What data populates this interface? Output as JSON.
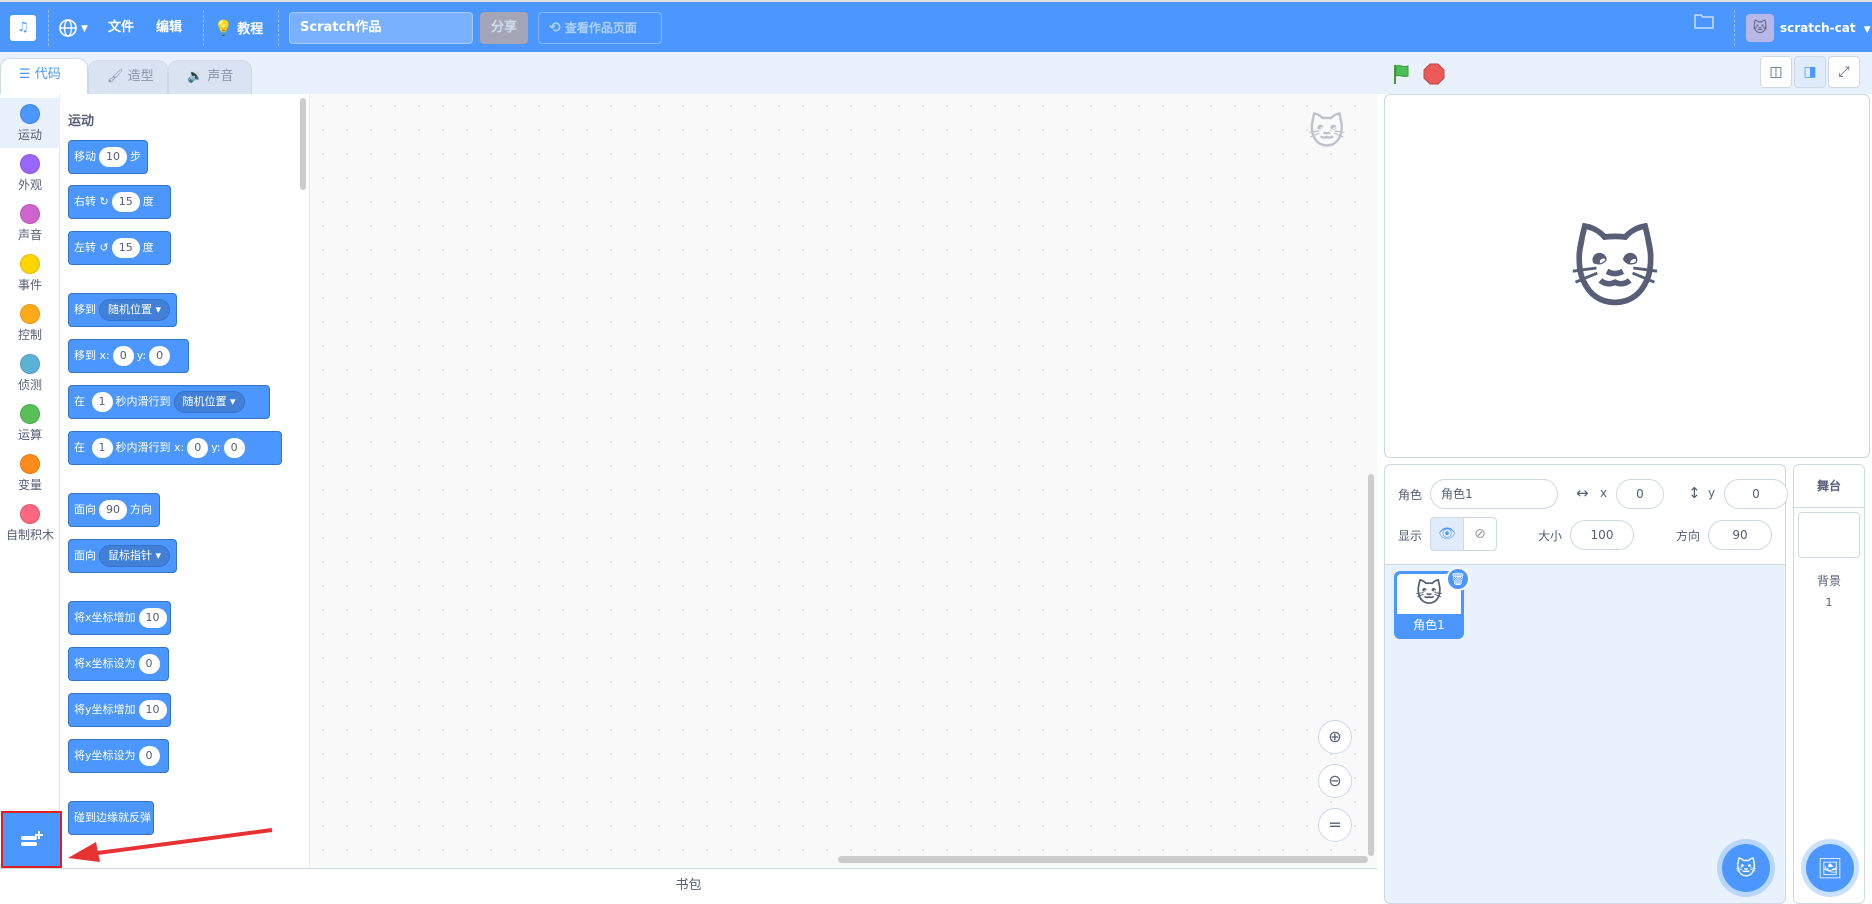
{
  "menubar": {
    "logo_text": "♫",
    "globe_icon": "globe-icon",
    "file_label": "文件",
    "edit_label": "编辑",
    "tutorial_label": "教程",
    "project_title": "Scratch作品",
    "share_label": "分享",
    "see_project_page_label": "查看作品页面",
    "my_stuff_icon": "folder-icon",
    "username": "scratch-cat",
    "brand_color": "#4c97ff"
  },
  "tabs": [
    {
      "label": "代码",
      "active": true,
      "icon": "code-icon"
    },
    {
      "label": "造型",
      "active": false,
      "icon": "brush-icon"
    },
    {
      "label": "声音",
      "active": false,
      "icon": "speaker-icon"
    }
  ],
  "categories": [
    {
      "label": "运动",
      "color": "#4c97ff"
    },
    {
      "label": "外观",
      "color": "#9966ff"
    },
    {
      "label": "声音",
      "color": "#cf63cf"
    },
    {
      "label": "事件",
      "color": "#ffd500"
    },
    {
      "label": "控制",
      "color": "#ffab19"
    },
    {
      "label": "侦测",
      "color": "#5cb1d6"
    },
    {
      "label": "运算",
      "color": "#59c059"
    },
    {
      "label": "变量",
      "color": "#ff8c1a"
    },
    {
      "label": "自制积木",
      "color": "#ff6680"
    }
  ],
  "palette": {
    "section_title": "运动",
    "blocks": {
      "move": {
        "a": "移动",
        "v": "10",
        "b": "步"
      },
      "turn_right": {
        "a": "右转",
        "v": "15",
        "b": "度"
      },
      "turn_left": {
        "a": "左转",
        "v": "15",
        "b": "度"
      },
      "goto": {
        "a": "移到",
        "menu": "随机位置"
      },
      "goto_xy": {
        "a": "移到 x:",
        "x": "0",
        "y_label": "y:",
        "y": "0"
      },
      "glide": {
        "a": "在",
        "v": "1",
        "b": "秒内滑行到",
        "menu": "随机位置"
      },
      "glide_xy": {
        "a": "在",
        "v": "1",
        "b": "秒内滑行到 x:",
        "x": "0",
        "y_label": "y:",
        "y": "0"
      },
      "point_dir": {
        "a": "面向",
        "v": "90",
        "b": "方向"
      },
      "point_towards": {
        "a": "面向",
        "menu": "鼠标指针"
      },
      "change_x": {
        "a": "将x坐标增加",
        "v": "10"
      },
      "set_x": {
        "a": "将x坐标设为",
        "v": "0"
      },
      "change_y": {
        "a": "将y坐标增加",
        "v": "10"
      },
      "set_y": {
        "a": "将y坐标设为",
        "v": "0"
      },
      "bounce": {
        "a": "碰到边缘就反弹"
      }
    }
  },
  "backpack_label": "书包",
  "sprite_info": {
    "sprite_label": "角色",
    "sprite_name": "角色1",
    "x_label": "x",
    "x_value": "0",
    "y_label": "y",
    "y_value": "0",
    "show_label": "显示",
    "size_label": "大小",
    "size_value": "100",
    "direction_label": "方向",
    "direction_value": "90"
  },
  "sprites": [
    {
      "name": "角色1",
      "selected": true
    }
  ],
  "stage_selector": {
    "title": "舞台",
    "backdrops_label": "背景",
    "backdrops_count": "1"
  }
}
